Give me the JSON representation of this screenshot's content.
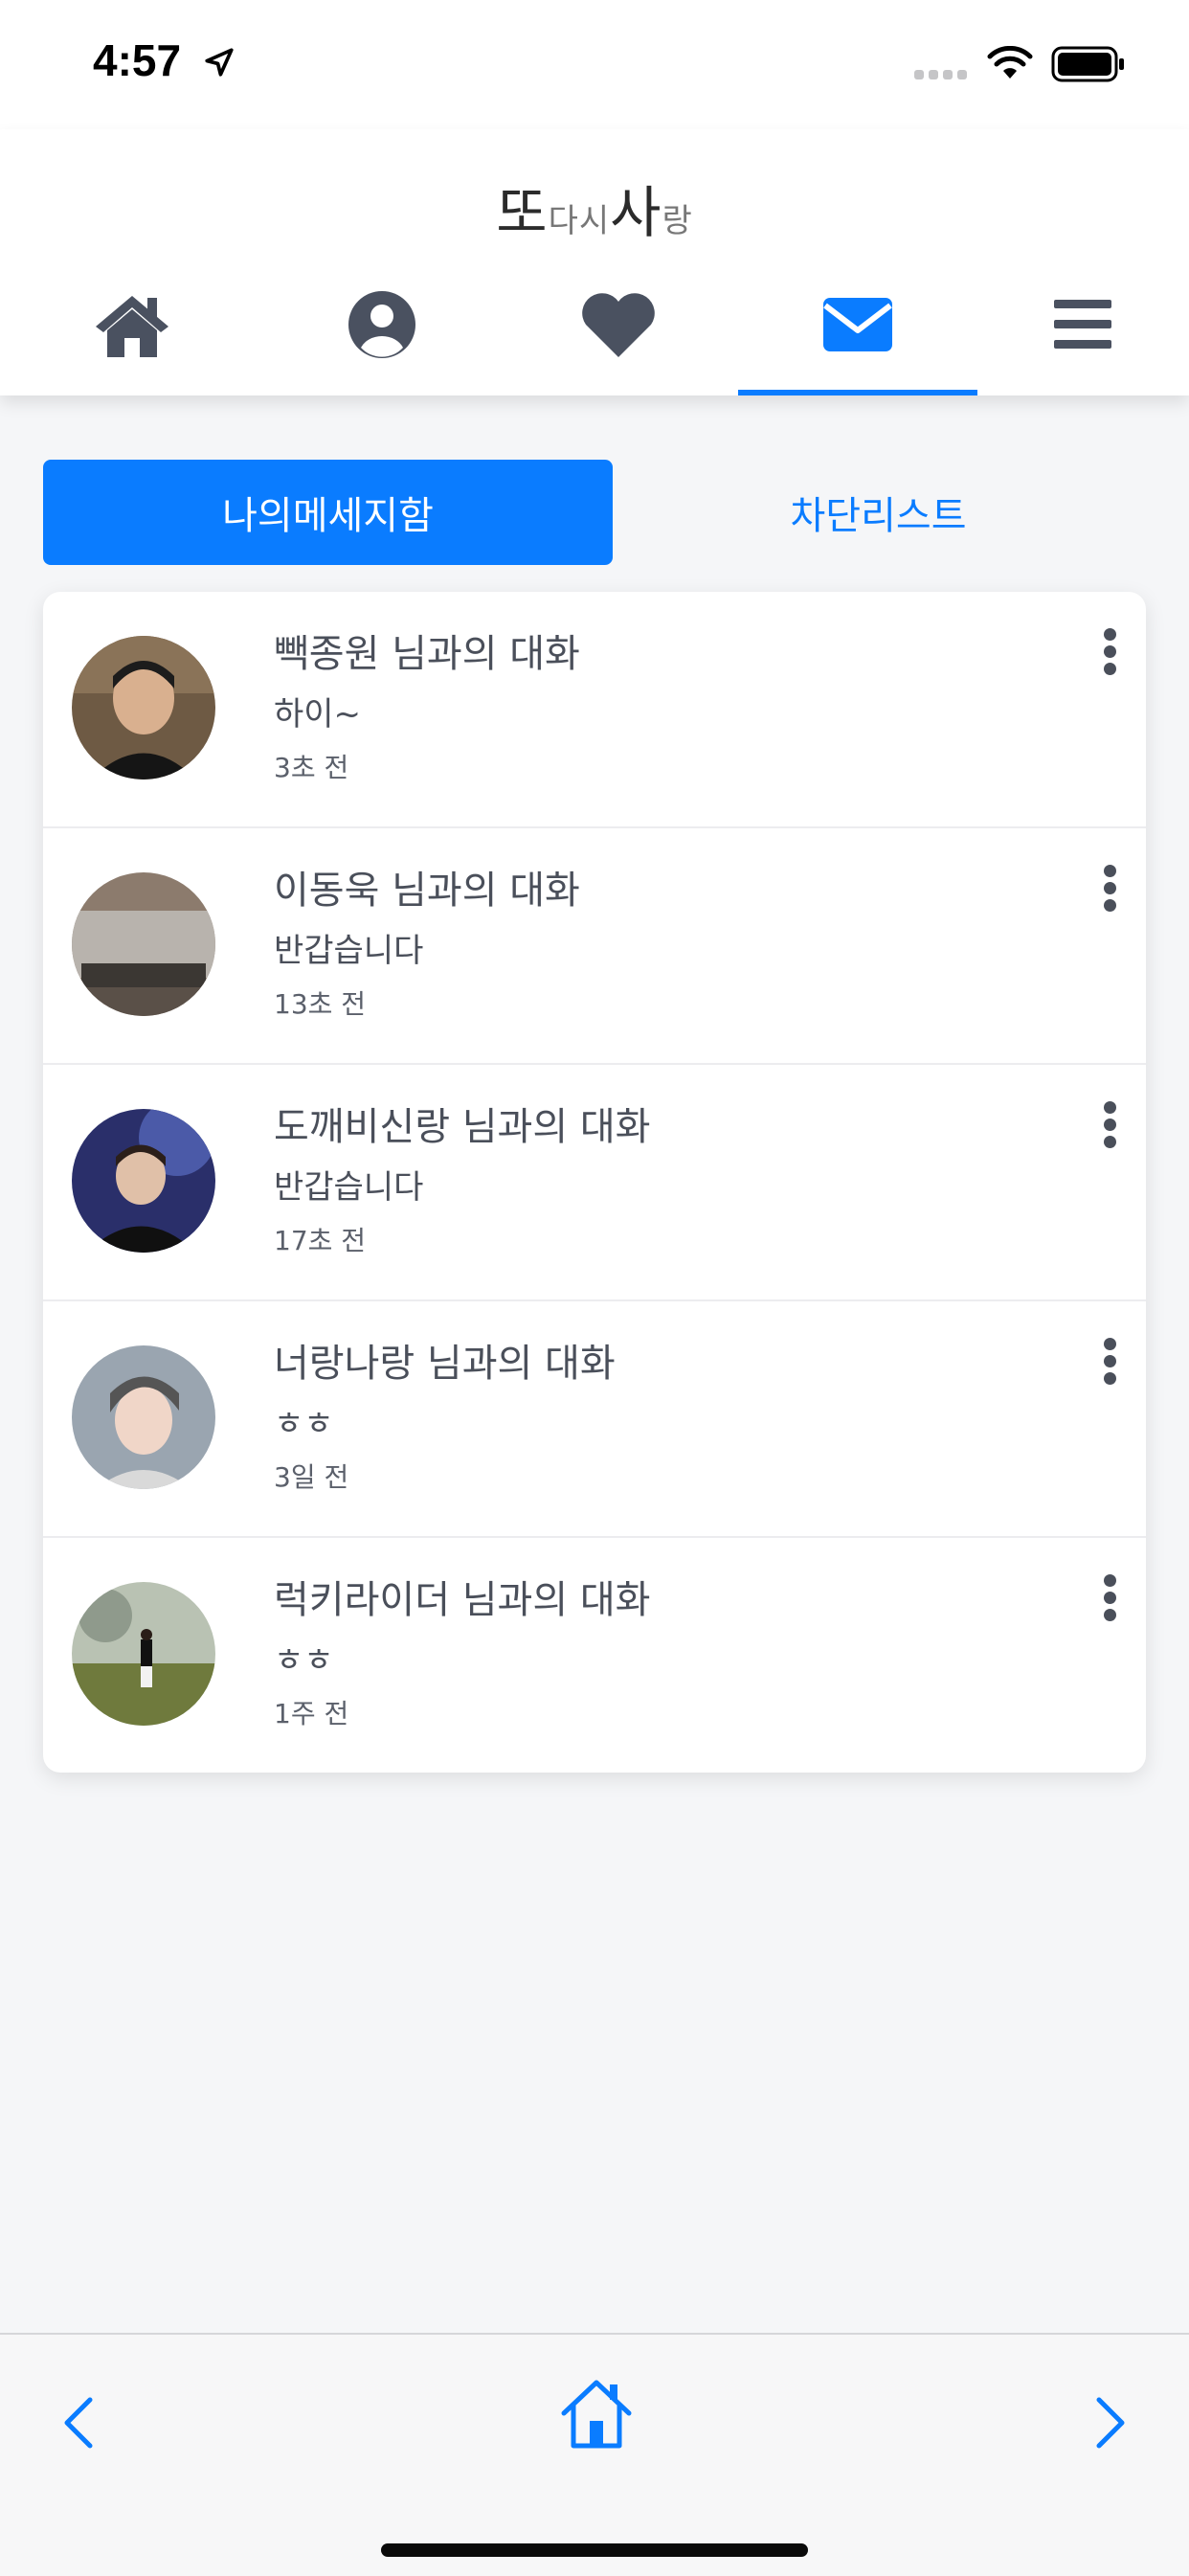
{
  "status_bar": {
    "time": "4:57"
  },
  "header": {
    "logo_main_1": "또",
    "logo_small": "다시",
    "logo_main_2": "사",
    "logo_small_2": "랑"
  },
  "nav": {
    "items": [
      {
        "icon": "home-icon"
      },
      {
        "icon": "user-circle-icon"
      },
      {
        "icon": "heart-icon"
      },
      {
        "icon": "envelope-icon",
        "active": true
      },
      {
        "icon": "menu-icon"
      }
    ]
  },
  "tabs": {
    "my_messages": "나의메세지함",
    "block_list": "차단리스트"
  },
  "conversations": [
    {
      "title": "빽종원 님과의 대화",
      "message": "하이~",
      "time": "3초 전"
    },
    {
      "title": "이동욱 님과의 대화",
      "message": "반갑습니다",
      "time": "13초 전"
    },
    {
      "title": "도깨비신랑 님과의 대화",
      "message": "반갑습니다",
      "time": "17초 전"
    },
    {
      "title": "너랑나랑 님과의 대화",
      "message": "ㅎㅎ",
      "time": "3일 전"
    },
    {
      "title": "럭키라이더 님과의 대화",
      "message": "ㅎㅎ",
      "time": "1주 전"
    }
  ],
  "colors": {
    "accent": "#0a7cff",
    "icon": "#4a5160",
    "background": "#f5f6f8"
  }
}
